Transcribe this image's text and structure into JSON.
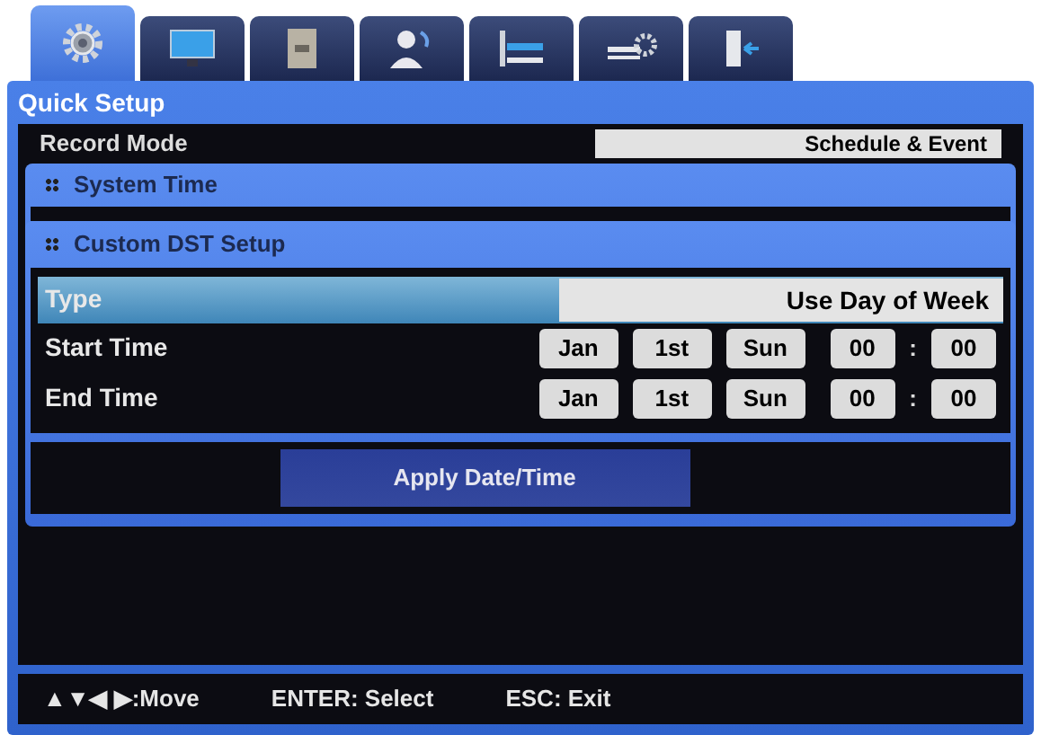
{
  "tabs": [
    {
      "selected": true
    },
    {
      "selected": false
    },
    {
      "selected": false
    },
    {
      "selected": false
    },
    {
      "selected": false
    },
    {
      "selected": false
    },
    {
      "selected": false
    }
  ],
  "panel": {
    "title": "Quick Setup",
    "rows": [
      {
        "label": "Record Mode",
        "value": "Schedule & Event"
      }
    ]
  },
  "system_time": {
    "title": "System Time"
  },
  "dst_dialog": {
    "title": "Custom DST Setup",
    "rows": [
      {
        "kind": "select",
        "label": "Type",
        "value": "Use Day of Week",
        "selected": true
      },
      {
        "kind": "datetime",
        "label": "Start Time",
        "month": "Jan",
        "week": "1st",
        "day": "Sun",
        "hour": "00",
        "separator": ":",
        "minute": "00",
        "selected": false
      },
      {
        "kind": "datetime",
        "label": "End Time",
        "month": "Jan",
        "week": "1st",
        "day": "Sun",
        "hour": "00",
        "separator": ":",
        "minute": "00",
        "selected": false
      }
    ],
    "button": "Apply Date/Time"
  },
  "footer": [
    "▲▼◀ ▶:Move",
    "ENTER: Select",
    "ESC: Exit"
  ]
}
